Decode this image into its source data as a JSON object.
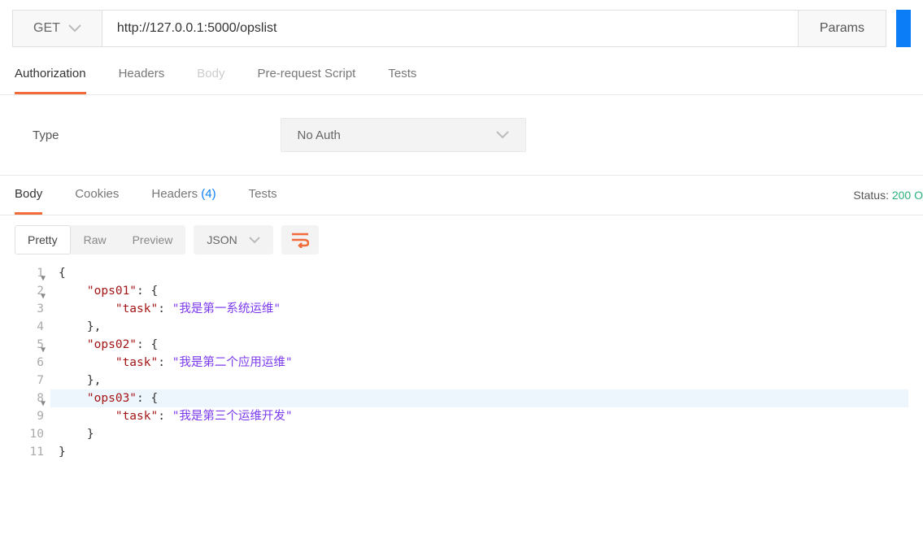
{
  "request": {
    "method": "GET",
    "url": "http://127.0.0.1:5000/opslist",
    "params_label": "Params"
  },
  "request_tabs": [
    {
      "label": "Authorization",
      "active": true,
      "disabled": false
    },
    {
      "label": "Headers",
      "active": false,
      "disabled": false
    },
    {
      "label": "Body",
      "active": false,
      "disabled": true
    },
    {
      "label": "Pre-request Script",
      "active": false,
      "disabled": false
    },
    {
      "label": "Tests",
      "active": false,
      "disabled": false
    }
  ],
  "auth": {
    "type_label": "Type",
    "selected": "No Auth"
  },
  "response_tabs": {
    "body": "Body",
    "cookies": "Cookies",
    "headers": "Headers",
    "headers_count": "(4)",
    "tests": "Tests"
  },
  "status": {
    "label": "Status:",
    "value": "200 O"
  },
  "viewer": {
    "pretty": "Pretty",
    "raw": "Raw",
    "preview": "Preview",
    "format": "JSON"
  },
  "code": {
    "lines": [
      {
        "num": "1",
        "fold": true,
        "indent": 0,
        "tokens": [
          {
            "t": "brace",
            "v": "{"
          }
        ]
      },
      {
        "num": "2",
        "fold": true,
        "indent": 1,
        "tokens": [
          {
            "t": "key",
            "v": "\"ops01\""
          },
          {
            "t": "colon",
            "v": ": "
          },
          {
            "t": "brace",
            "v": "{"
          }
        ]
      },
      {
        "num": "3",
        "fold": false,
        "indent": 2,
        "tokens": [
          {
            "t": "key",
            "v": "\"task\""
          },
          {
            "t": "colon",
            "v": ": "
          },
          {
            "t": "string",
            "v": "\"我是第一系统运维\""
          }
        ]
      },
      {
        "num": "4",
        "fold": false,
        "indent": 1,
        "tokens": [
          {
            "t": "brace",
            "v": "},"
          }
        ]
      },
      {
        "num": "5",
        "fold": true,
        "indent": 1,
        "tokens": [
          {
            "t": "key",
            "v": "\"ops02\""
          },
          {
            "t": "colon",
            "v": ": "
          },
          {
            "t": "brace",
            "v": "{"
          }
        ]
      },
      {
        "num": "6",
        "fold": false,
        "indent": 2,
        "tokens": [
          {
            "t": "key",
            "v": "\"task\""
          },
          {
            "t": "colon",
            "v": ": "
          },
          {
            "t": "string",
            "v": "\"我是第二个应用运维\""
          }
        ]
      },
      {
        "num": "7",
        "fold": false,
        "indent": 1,
        "tokens": [
          {
            "t": "brace",
            "v": "},"
          }
        ]
      },
      {
        "num": "8",
        "fold": true,
        "indent": 1,
        "highlight": true,
        "tokens": [
          {
            "t": "key",
            "v": "\"ops03\""
          },
          {
            "t": "colon",
            "v": ": "
          },
          {
            "t": "brace",
            "v": "{"
          }
        ]
      },
      {
        "num": "9",
        "fold": false,
        "indent": 2,
        "tokens": [
          {
            "t": "key",
            "v": "\"task\""
          },
          {
            "t": "colon",
            "v": ": "
          },
          {
            "t": "string",
            "v": "\"我是第三个运维开发\""
          }
        ]
      },
      {
        "num": "10",
        "fold": false,
        "indent": 1,
        "tokens": [
          {
            "t": "brace",
            "v": "}"
          }
        ]
      },
      {
        "num": "11",
        "fold": false,
        "indent": 0,
        "tokens": [
          {
            "t": "brace",
            "v": "}"
          }
        ]
      }
    ]
  }
}
